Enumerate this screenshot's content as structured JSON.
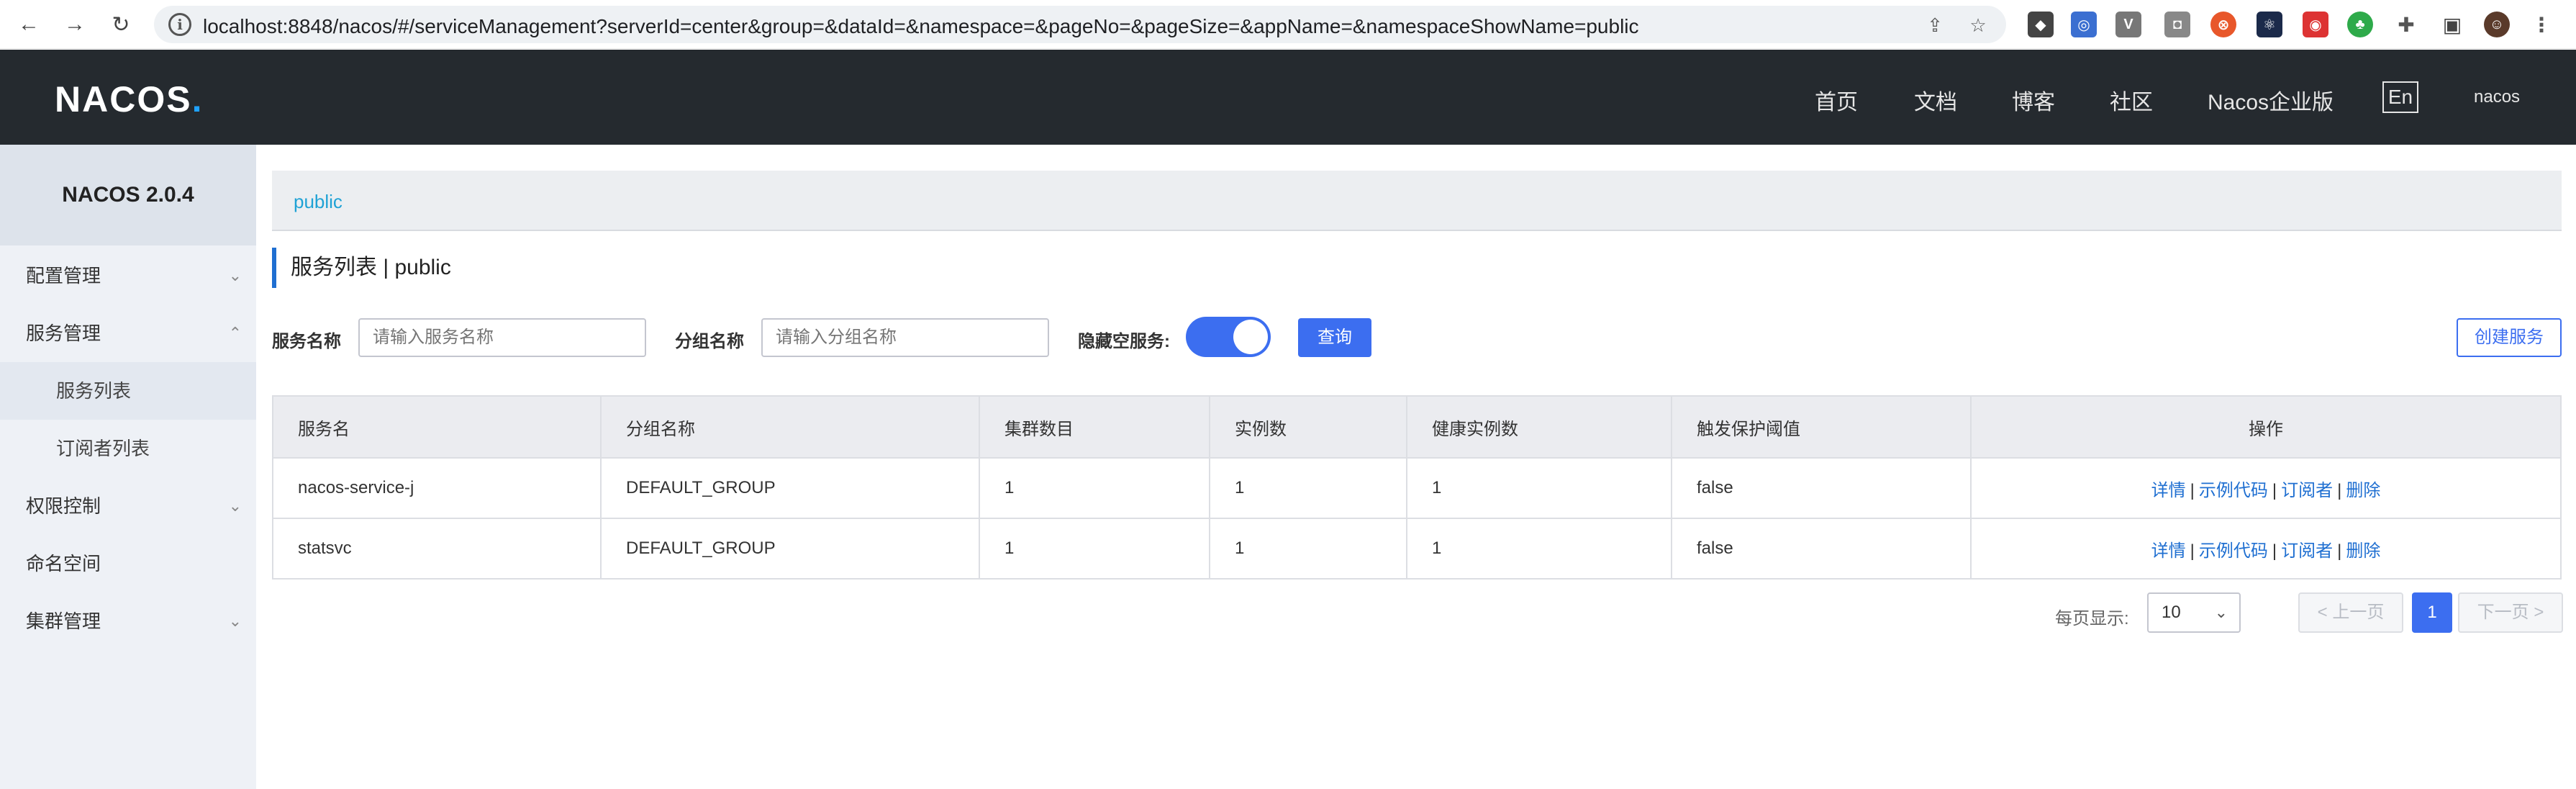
{
  "browser": {
    "url": "localhost:8848/nacos/#/serviceManagement?serverId=center&group=&dataId=&namespace=&pageNo=&pageSize=&appName=&namespaceShowName=public",
    "back_icon": "arrow-left-icon",
    "forward_icon": "arrow-right-icon",
    "reload_icon": "reload-icon"
  },
  "header": {
    "logo": "NACOS",
    "nav": [
      "首页",
      "文档",
      "博客",
      "社区",
      "Nacos企业版"
    ],
    "lang": "En",
    "user": "nacos"
  },
  "sidebar": {
    "title": "NACOS 2.0.4",
    "items": [
      {
        "label": "配置管理",
        "chevron": "⌄"
      },
      {
        "label": "服务管理",
        "chevron": "⌃"
      },
      {
        "label": "服务列表"
      },
      {
        "label": "订阅者列表"
      },
      {
        "label": "权限控制",
        "chevron": "⌄"
      },
      {
        "label": "命名空间"
      },
      {
        "label": "集群管理",
        "chevron": "⌄"
      }
    ]
  },
  "main": {
    "breadcrumb": "public",
    "page_title": "服务列表  |  public",
    "filters": {
      "service_name_label": "服务名称",
      "service_name_placeholder": "请输入服务名称",
      "group_name_label": "分组名称",
      "group_name_placeholder": "请输入分组名称",
      "hide_empty_label": "隐藏空服务:",
      "hide_empty_on": true,
      "query_button": "查询",
      "create_button": "创建服务"
    },
    "table": {
      "columns": [
        "服务名",
        "分组名称",
        "集群数目",
        "实例数",
        "健康实例数",
        "触发保护阈值",
        "操作"
      ],
      "rows": [
        [
          "nacos-service-j",
          "DEFAULT_GROUP",
          "1",
          "1",
          "1",
          "false"
        ],
        [
          "statsvc",
          "DEFAULT_GROUP",
          "1",
          "1",
          "1",
          "false"
        ]
      ],
      "actions": [
        "详情",
        "示例代码",
        "订阅者",
        "删除"
      ]
    },
    "pagination": {
      "page_size_label": "每页显示:",
      "page_size": "10",
      "prev": "< 上一页",
      "current": "1",
      "next": "下一页 >"
    }
  },
  "colors": {
    "header_bg": "#252a2f",
    "sidebar_bg": "#eef1f6",
    "primary": "#3c6ef0",
    "link": "#1f6fd1"
  }
}
